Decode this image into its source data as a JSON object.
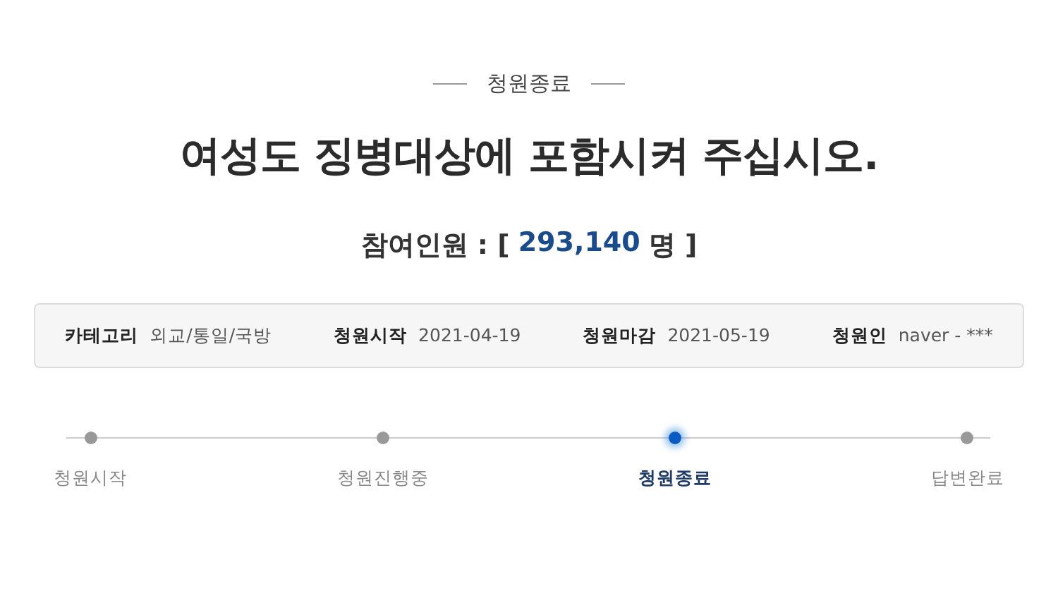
{
  "status": "청원종료",
  "title": "여성도 징병대상에 포함시켜 주십시오.",
  "participants": {
    "label": "참여인원 : [",
    "count": "293,140",
    "suffix": "명 ]"
  },
  "info": [
    {
      "label": "카테고리",
      "value": "외교/통일/국방"
    },
    {
      "label": "청원시작",
      "value": "2021-04-19"
    },
    {
      "label": "청원마감",
      "value": "2021-05-19"
    },
    {
      "label": "청원인",
      "value": "naver - ***"
    }
  ],
  "steps": [
    {
      "label": "청원시작",
      "selected": false
    },
    {
      "label": "청원진행중",
      "selected": false
    },
    {
      "label": "청원종료",
      "selected": true
    },
    {
      "label": "답변완료",
      "selected": false
    }
  ]
}
